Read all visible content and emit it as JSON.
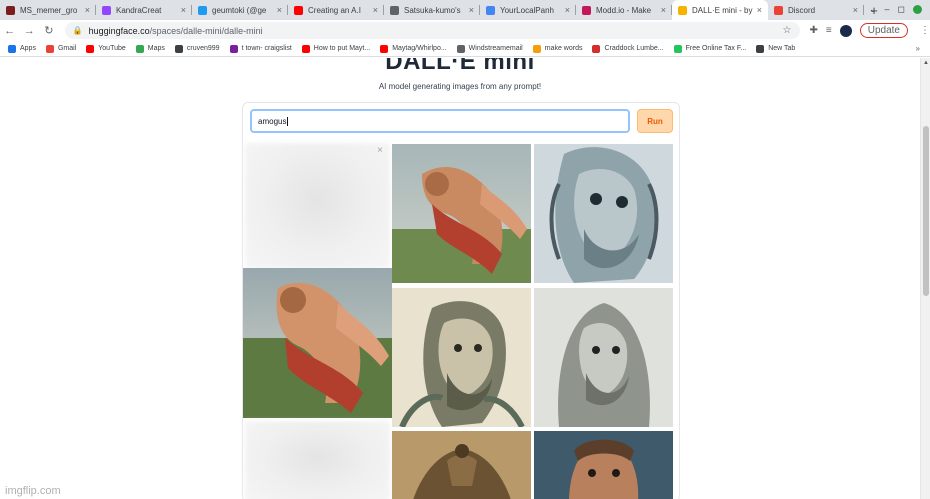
{
  "tabs": [
    {
      "title": "MS_memer_gro",
      "color": "#7b1e1e",
      "active": false
    },
    {
      "title": "KandraCreat",
      "color": "#9146ff",
      "active": false
    },
    {
      "title": "geumtoki (@ge",
      "color": "#1d9bf0",
      "active": false
    },
    {
      "title": "Creating an A.I",
      "color": "#ff0000",
      "active": false
    },
    {
      "title": "Satsuka-kumo's",
      "color": "#5f6368",
      "active": false
    },
    {
      "title": "YourLocalPanh",
      "color": "#4285f4",
      "active": false
    },
    {
      "title": "Modd.io - Make",
      "color": "#c2185b",
      "active": false
    },
    {
      "title": "DALL·E mini - by",
      "color": "#f4b400",
      "active": true
    },
    {
      "title": "Discord",
      "color": "#ea4335",
      "active": false
    }
  ],
  "toolbar": {
    "url_host": "huggingface.co",
    "url_path": "/spaces/dalle-mini/dalle-mini",
    "update_label": "Update"
  },
  "bookmarks": [
    {
      "label": "Apps",
      "color": "#1a73e8"
    },
    {
      "label": "Gmail",
      "color": "#ea4335"
    },
    {
      "label": "YouTube",
      "color": "#ff0000"
    },
    {
      "label": "Maps",
      "color": "#34a853"
    },
    {
      "label": "cruven999",
      "color": "#3c4043"
    },
    {
      "label": "t town- craigslist",
      "color": "#7b1fa2"
    },
    {
      "label": "How to put Mayt...",
      "color": "#ff0000"
    },
    {
      "label": "Maytag/Whirlpo...",
      "color": "#ff0000"
    },
    {
      "label": "Windstreamemail",
      "color": "#5f6368"
    },
    {
      "label": "make words",
      "color": "#f59e0b"
    },
    {
      "label": "Craddock Lumbe...",
      "color": "#d32f2f"
    },
    {
      "label": "Free Online Tax F...",
      "color": "#22c55e"
    },
    {
      "label": "New Tab",
      "color": "#3c4043"
    }
  ],
  "page": {
    "heading": "DALL·E mini",
    "subtitle": "AI model generating images from any prompt!",
    "prompt_value": "amogus",
    "run_label": "Run"
  },
  "gallery": [
    {
      "kind": "placeholder"
    },
    {
      "kind": "reclining-figure"
    },
    {
      "kind": "bearded-sculpture"
    },
    {
      "kind": "reclining-figure-large"
    },
    {
      "kind": "bearded-sketch"
    },
    {
      "kind": "hooded-sketch"
    },
    {
      "kind": "placeholder"
    },
    {
      "kind": "ship-engraving"
    },
    {
      "kind": "portrait-man"
    }
  ],
  "watermark": "imgflip.com"
}
